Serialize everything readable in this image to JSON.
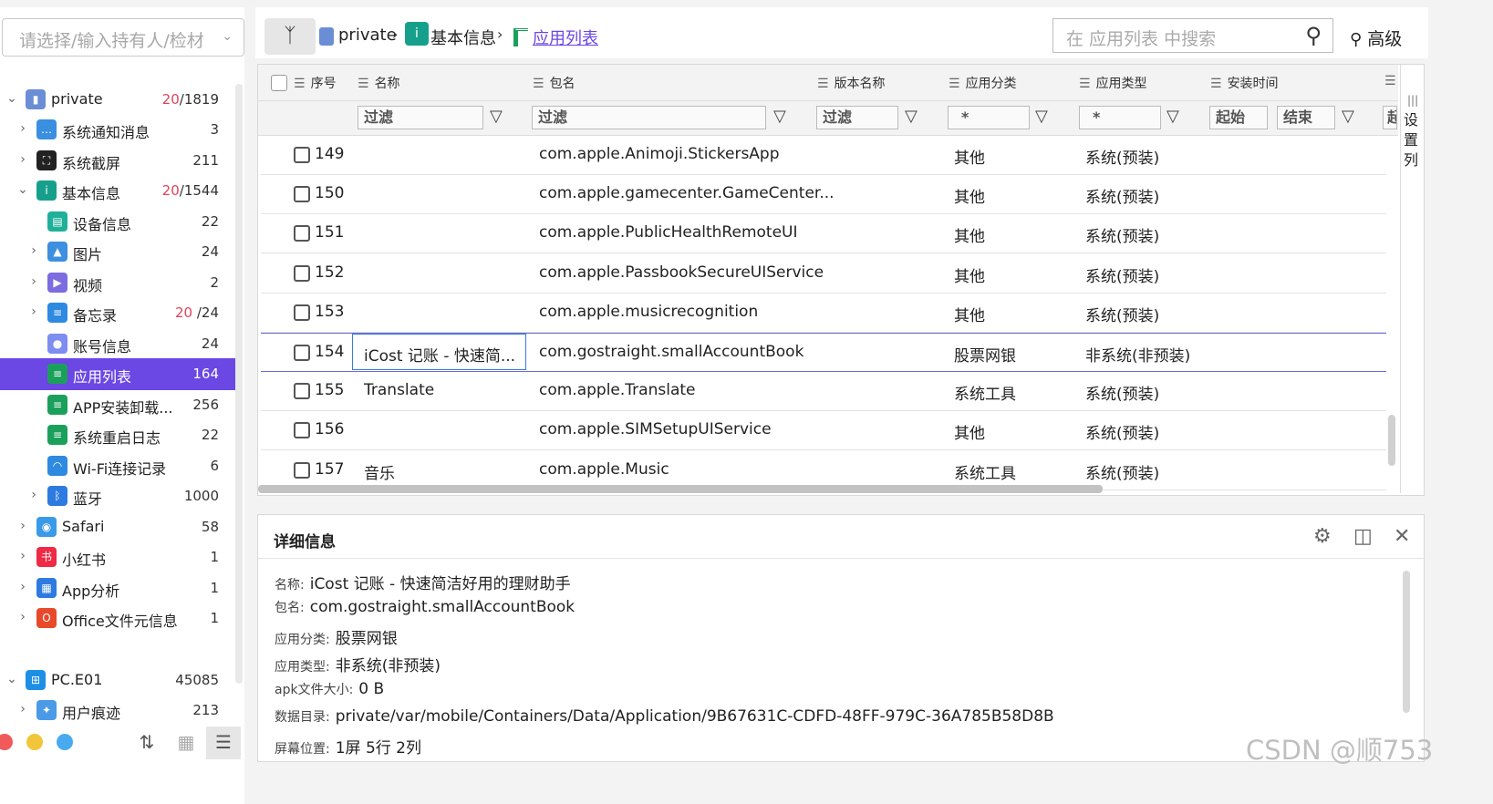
{
  "sidebar": {
    "holder_placeholder": "请选择/输入持有人/检材",
    "tree": [
      {
        "label": "private",
        "count_red": "20",
        "count": "/1819",
        "expanded": true,
        "level": 0,
        "icon": "phone-icon",
        "color": "#6b8dd6"
      },
      {
        "label": "系统通知消息",
        "count": "3",
        "level": 1,
        "icon": "chat-icon",
        "color": "#3a8fe0"
      },
      {
        "label": "系统截屏",
        "count": "211",
        "level": 1,
        "icon": "screenshot-icon",
        "color": "#222222"
      },
      {
        "label": "基本信息",
        "count_red": "20",
        "count": "/1544",
        "expanded": true,
        "level": 1,
        "icon": "info-icon",
        "color": "#16a08c"
      },
      {
        "label": "设备信息",
        "count": "22",
        "level": 2,
        "icon": "device-icon",
        "color": "#20b09a"
      },
      {
        "label": "图片",
        "count": "24",
        "level": 2,
        "icon": "picture-icon",
        "color": "#3d8fe0"
      },
      {
        "label": "视频",
        "count": "2",
        "level": 2,
        "icon": "video-icon",
        "color": "#7b6ce0"
      },
      {
        "label": "备忘录",
        "count_red": "20",
        "count": " /24",
        "level": 2,
        "icon": "memo-icon",
        "color": "#2d8ae0"
      },
      {
        "label": "账号信息",
        "count": "24",
        "level": 2,
        "icon": "account-icon",
        "color": "#7d8ef0"
      },
      {
        "label": "应用列表",
        "count": "164",
        "level": 2,
        "icon": "list-icon",
        "color": "#1ba05c",
        "selected": true
      },
      {
        "label": "APP安装卸载...",
        "count": "256",
        "level": 2,
        "icon": "list-icon",
        "color": "#1ba05c"
      },
      {
        "label": "系统重启日志",
        "count": "22",
        "level": 2,
        "icon": "list-icon",
        "color": "#1ba05c"
      },
      {
        "label": "Wi-Fi连接记录",
        "count": "6",
        "level": 2,
        "icon": "wifi-icon",
        "color": "#2d8ae0"
      },
      {
        "label": "蓝牙",
        "count": "1000",
        "level": 2,
        "icon": "bluetooth-icon",
        "color": "#2d7be0"
      },
      {
        "label": "Safari",
        "count": "58",
        "level": 1,
        "icon": "safari-icon",
        "color": "#3a9ae8"
      },
      {
        "label": "小红书",
        "count": "1",
        "level": 1,
        "icon": "xiaohongshu-icon",
        "color": "#ee2a45"
      },
      {
        "label": "App分析",
        "count": "1",
        "level": 1,
        "icon": "app-grid-icon",
        "color": "#2d7be0"
      },
      {
        "label": "Office文件元信息",
        "count": "1",
        "level": 1,
        "icon": "office-icon",
        "color": "#e8492a"
      },
      {
        "label": "PC.E01",
        "count": "45085",
        "expanded": true,
        "level": 0,
        "icon": "windows-icon",
        "color": "#1f8fe6"
      },
      {
        "label": "用户痕迹",
        "count": "213",
        "level": 1,
        "icon": "user-trace-icon",
        "color": "#4a9ae8"
      }
    ]
  },
  "breadcrumb": {
    "items": [
      "private",
      "基本信息",
      "应用列表"
    ]
  },
  "search": {
    "placeholder": "在 应用列表 中搜索"
  },
  "toolbar": {
    "advanced_label": "高级"
  },
  "grid": {
    "columns": [
      "序号",
      "名称",
      "包名",
      "版本名称",
      "应用分类",
      "应用类型",
      "安装时间"
    ],
    "filters": {
      "name": "过滤",
      "package": "过滤",
      "version": "过滤",
      "category": "*",
      "type": "*",
      "start": "起始",
      "end": "结束",
      "extra": "起"
    },
    "col_settings_label": "设置列",
    "rows": [
      {
        "index": "149",
        "name": "",
        "package": "com.apple.Animoji.StickersApp",
        "category": "其他",
        "type": "系统(预装)"
      },
      {
        "index": "150",
        "name": "",
        "package": "com.apple.gamecenter.GameCenter...",
        "category": "其他",
        "type": "系统(预装)"
      },
      {
        "index": "151",
        "name": "",
        "package": "com.apple.PublicHealthRemoteUI",
        "category": "其他",
        "type": "系统(预装)"
      },
      {
        "index": "152",
        "name": "",
        "package": "com.apple.PassbookSecureUIService",
        "category": "其他",
        "type": "系统(预装)"
      },
      {
        "index": "153",
        "name": "",
        "package": "com.apple.musicrecognition",
        "category": "其他",
        "type": "系统(预装)"
      },
      {
        "index": "154",
        "name": "iCost 记账 - 快速简...",
        "package": "com.gostraight.smallAccountBook",
        "category": "股票网银",
        "type": "非系统(非预装)",
        "selected": true
      },
      {
        "index": "155",
        "name": "Translate",
        "package": "com.apple.Translate",
        "category": "系统工具",
        "type": "系统(预装)"
      },
      {
        "index": "156",
        "name": "",
        "package": "com.apple.SIMSetupUIService",
        "category": "其他",
        "type": "系统(预装)"
      },
      {
        "index": "157",
        "name": "音乐",
        "package": "com.apple.Music",
        "category": "系统工具",
        "type": "系统(预装)"
      }
    ]
  },
  "detail": {
    "title": "详细信息",
    "fields": [
      {
        "label": "名称:",
        "value": "iCost 记账 - 快速简洁好用的理财助手"
      },
      {
        "label": "包名:",
        "value": "com.gostraight.smallAccountBook"
      },
      {
        "label": "应用分类:",
        "value": "股票网银"
      },
      {
        "label": "应用类型:",
        "value": "非系统(非预装)"
      },
      {
        "label": "apk文件大小:",
        "value": "0 B"
      },
      {
        "label": "数据目录:",
        "value": "private/var/mobile/Containers/Data/Application/9B67631C-CDFD-48FF-979C-36A785B58D8B"
      },
      {
        "label": "屏幕位置:",
        "value": "1屏 5行 2列"
      }
    ]
  },
  "watermark": "CSDN @顺753"
}
